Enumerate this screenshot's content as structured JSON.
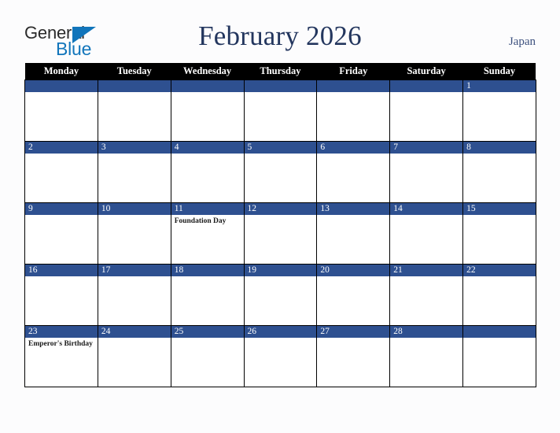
{
  "brand": {
    "name_part1": "General",
    "name_part2": "Blue",
    "triangle_color": "#1175bb",
    "part1_color": "#2b2b2b",
    "part2_color": "#1175bb"
  },
  "header": {
    "title": "February 2026",
    "country": "Japan",
    "title_color": "#23365e",
    "country_color": "#3b4f7d"
  },
  "calendar": {
    "month": "February",
    "year": "2026",
    "weekday_headers": [
      "Monday",
      "Tuesday",
      "Wednesday",
      "Thursday",
      "Friday",
      "Saturday",
      "Sunday"
    ],
    "header_bg": "#000000",
    "header_fg": "#ffffff",
    "date_bar_bg": "#2e5090",
    "date_bar_fg": "#ffffff",
    "cell_bg": "#ffffff",
    "grid_line_color": "#000000",
    "weeks": [
      [
        {
          "date": "",
          "event": ""
        },
        {
          "date": "",
          "event": ""
        },
        {
          "date": "",
          "event": ""
        },
        {
          "date": "",
          "event": ""
        },
        {
          "date": "",
          "event": ""
        },
        {
          "date": "",
          "event": ""
        },
        {
          "date": "1",
          "event": ""
        }
      ],
      [
        {
          "date": "2",
          "event": ""
        },
        {
          "date": "3",
          "event": ""
        },
        {
          "date": "4",
          "event": ""
        },
        {
          "date": "5",
          "event": ""
        },
        {
          "date": "6",
          "event": ""
        },
        {
          "date": "7",
          "event": ""
        },
        {
          "date": "8",
          "event": ""
        }
      ],
      [
        {
          "date": "9",
          "event": ""
        },
        {
          "date": "10",
          "event": ""
        },
        {
          "date": "11",
          "event": "Foundation Day"
        },
        {
          "date": "12",
          "event": ""
        },
        {
          "date": "13",
          "event": ""
        },
        {
          "date": "14",
          "event": ""
        },
        {
          "date": "15",
          "event": ""
        }
      ],
      [
        {
          "date": "16",
          "event": ""
        },
        {
          "date": "17",
          "event": ""
        },
        {
          "date": "18",
          "event": ""
        },
        {
          "date": "19",
          "event": ""
        },
        {
          "date": "20",
          "event": ""
        },
        {
          "date": "21",
          "event": ""
        },
        {
          "date": "22",
          "event": ""
        }
      ],
      [
        {
          "date": "23",
          "event": "Emperor's Birthday"
        },
        {
          "date": "24",
          "event": ""
        },
        {
          "date": "25",
          "event": ""
        },
        {
          "date": "26",
          "event": ""
        },
        {
          "date": "27",
          "event": ""
        },
        {
          "date": "28",
          "event": ""
        },
        {
          "date": "",
          "event": ""
        }
      ]
    ]
  }
}
